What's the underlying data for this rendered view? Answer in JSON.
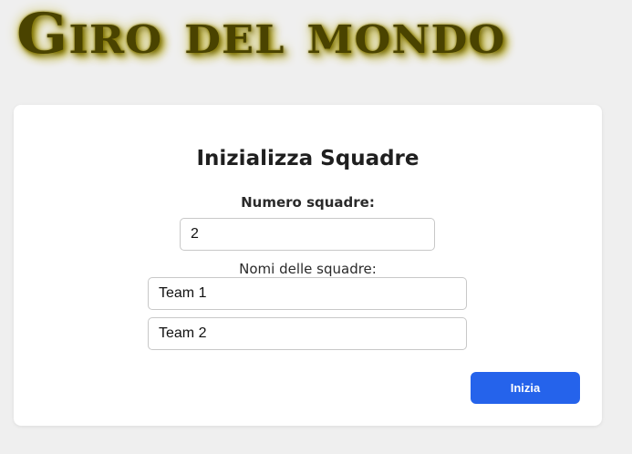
{
  "app": {
    "logo_text": "Giro del mondo"
  },
  "form": {
    "title": "Inizializza Squadre",
    "team_count_label": "Numero squadre:",
    "team_count_value": "2",
    "team_names_label": "Nomi delle squadre:",
    "team_names": [
      "Team 1",
      "Team 2"
    ],
    "start_button_label": "Inizia"
  },
  "colors": {
    "page_background": "#efefef",
    "card_background": "#ffffff",
    "accent": "#2563eb",
    "logo": "#4a4300"
  }
}
